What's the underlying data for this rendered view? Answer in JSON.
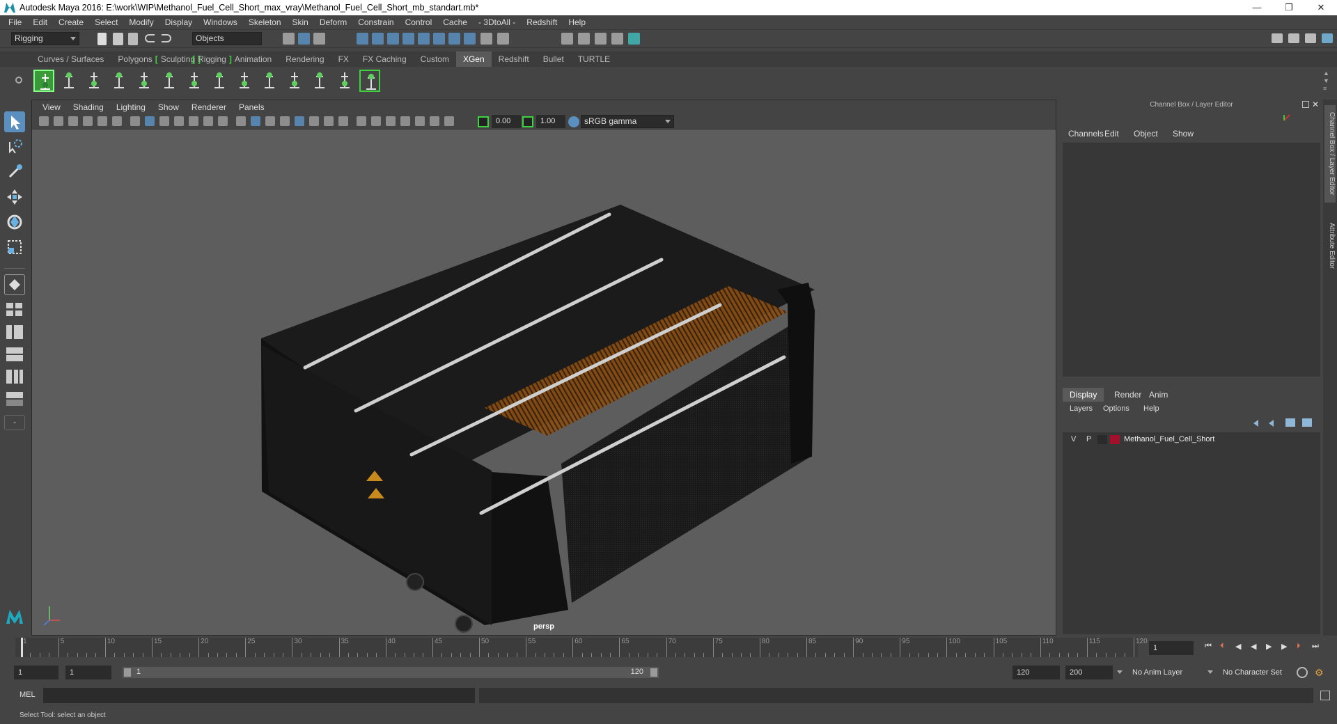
{
  "title": "Autodesk Maya 2016: E:\\work\\WIP\\Methanol_Fuel_Cell_Short_max_vray\\Methanol_Fuel_Cell_Short_mb_standart.mb*",
  "window_buttons": {
    "minimize": "—",
    "maximize": "❐",
    "close": "✕"
  },
  "menu": [
    "File",
    "Edit",
    "Create",
    "Select",
    "Modify",
    "Display",
    "Windows",
    "Skeleton",
    "Skin",
    "Deform",
    "Constrain",
    "Control",
    "Cache",
    "- 3DtoAll -",
    "Redshift",
    "Help"
  ],
  "status_line": {
    "menu_set": "Rigging",
    "selection_mode": "Objects"
  },
  "shelf_tabs": [
    "Curves / Surfaces",
    "Polygons",
    "Sculpting",
    "Rigging",
    "Animation",
    "Rendering",
    "FX",
    "FX Caching",
    "Custom",
    "XGen",
    "Redshift",
    "Bullet",
    "TURTLE"
  ],
  "active_shelf_tab": "XGen",
  "viewport": {
    "menu": [
      "View",
      "Shading",
      "Lighting",
      "Show",
      "Renderer",
      "Panels"
    ],
    "exposure": "0.00",
    "gamma": "1.00",
    "color_space": "sRGB gamma",
    "camera_label": "persp"
  },
  "channel_box": {
    "header": "Channel Box / Layer Editor",
    "menu": [
      "Channels",
      "Edit",
      "Object",
      "Show"
    ]
  },
  "layer_editor": {
    "tabs": [
      "Display",
      "Render",
      "Anim"
    ],
    "active_tab": "Display",
    "menu": [
      "Layers",
      "Options",
      "Help"
    ],
    "layers": [
      {
        "v": "V",
        "p": "P",
        "color": "#a3102a",
        "name": "Methanol_Fuel_Cell_Short"
      }
    ]
  },
  "side_tabs": [
    "Channel Box / Layer Editor",
    "Attribute Editor"
  ],
  "timeline": {
    "ticks": [
      1,
      5,
      10,
      15,
      20,
      25,
      30,
      35,
      40,
      45,
      50,
      55,
      60,
      65,
      70,
      75,
      80,
      85,
      90,
      95,
      100,
      105,
      110,
      115,
      120
    ],
    "current_frame": "1"
  },
  "range": {
    "start": "1",
    "playback_start": "1",
    "slider_start": "1",
    "slider_end": "120",
    "playback_end": "120",
    "end": "200",
    "anim_layer": "No Anim Layer",
    "character_set": "No Character Set"
  },
  "command_line": {
    "label": "MEL"
  },
  "help_line": "Select Tool: select an object",
  "colors": {
    "accent_green": "#3fd23f",
    "layer_color": "#a3102a",
    "active_tool": "#5a8fbf"
  }
}
